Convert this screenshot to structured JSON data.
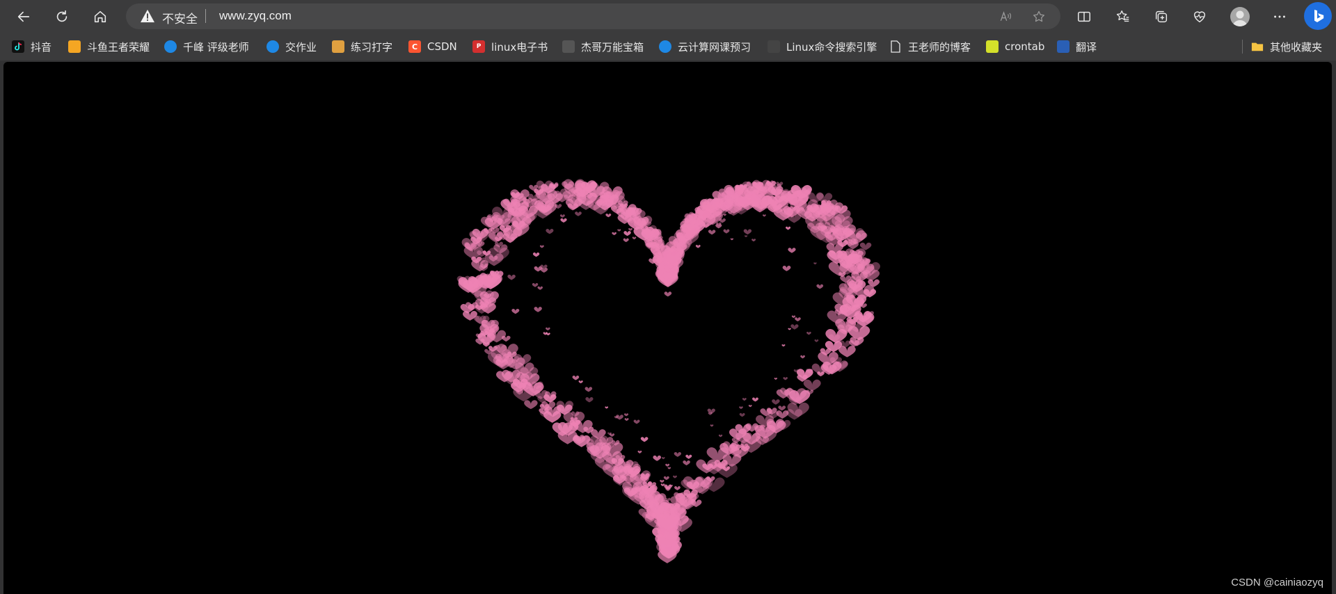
{
  "address_bar": {
    "security_label": "不安全",
    "url": "www.zyq.com"
  },
  "icons": {
    "back": "back-arrow-icon",
    "refresh": "refresh-icon",
    "home": "home-icon",
    "warning": "warning-icon",
    "read_aloud": "read-aloud-icon",
    "favorite": "star-icon",
    "split": "split-screen-icon",
    "favorites": "favorites-icon",
    "collections": "collections-icon",
    "performance": "heart-pulse-icon",
    "profile": "profile-icon",
    "more": "more-icon",
    "copilot": "bing-icon"
  },
  "bookmarks": [
    {
      "label": "抖音",
      "icon": "douyin-icon",
      "color": "#111111"
    },
    {
      "label": "斗鱼王者荣耀",
      "icon": "douyu-icon",
      "color": "#f5a623"
    },
    {
      "label": "千峰 评级老师",
      "icon": "qianfeng-icon",
      "color": "#1e88e5"
    },
    {
      "label": "交作业",
      "icon": "globe-icon",
      "color": "#1e88e5"
    },
    {
      "label": "练习打字",
      "icon": "typing-icon",
      "color": "#e0a040"
    },
    {
      "label": "CSDN",
      "icon": "csdn-icon",
      "color": "#fc5531"
    },
    {
      "label": "linux电子书",
      "icon": "pdf-icon",
      "color": "#d32f2f"
    },
    {
      "label": "杰哥万能宝箱",
      "icon": "box-icon",
      "color": "#555555"
    },
    {
      "label": "云计算网课预习",
      "icon": "cloud-icon",
      "color": "#1e88e5"
    },
    {
      "label": "Linux命令搜索引擎",
      "icon": "linux-icon",
      "color": "#444444"
    },
    {
      "label": "王老师的博客",
      "icon": "page-icon",
      "color": "#3b3b3c"
    },
    {
      "label": "crontab",
      "icon": "crontab-icon",
      "color": "#d4e02a"
    },
    {
      "label": "翻译",
      "icon": "translate-icon",
      "color": "#2a5fb5"
    }
  ],
  "other_bookmarks": {
    "label": "其他收藏夹",
    "icon": "folder-icon",
    "color": "#f6c443"
  },
  "page": {
    "watermark": "CSDN @cainiaozyq",
    "heart_color": "#ee82b4",
    "background": "#000000"
  }
}
